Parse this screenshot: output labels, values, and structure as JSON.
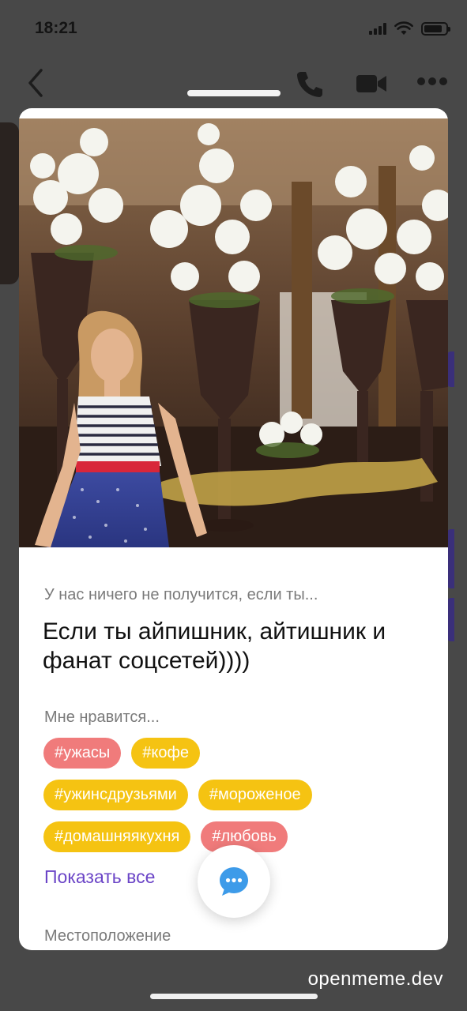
{
  "status_bar": {
    "time": "18:21"
  },
  "profile": {
    "prompt_question": "У нас ничего не получится, если ты...",
    "prompt_answer": "Если ты айпишник, айтишник и фанат соцсетей))))",
    "likes_label": "Мне нравится...",
    "tags": [
      {
        "label": "#ужасы",
        "color": "#f07b7b"
      },
      {
        "label": "#кофе",
        "color": "#f5c312"
      },
      {
        "label": "#ужинсдрузьями",
        "color": "#f5c312"
      },
      {
        "label": "#мороженое",
        "color": "#f5c312"
      },
      {
        "label": "#домашняякухня",
        "color": "#f5c312"
      },
      {
        "label": "#любовь",
        "color": "#f07b7b"
      }
    ],
    "show_all_label": "Показать все",
    "location_label": "Местоположение"
  },
  "icons": {
    "back": "chevron-left-icon",
    "call": "phone-icon",
    "video": "video-camera-icon",
    "more": "more-dots-icon",
    "chat": "chat-bubble-icon"
  },
  "accent_colors": {
    "link": "#6b45c7",
    "chat_icon": "#3d9be9"
  },
  "watermark": "openmeme.dev"
}
